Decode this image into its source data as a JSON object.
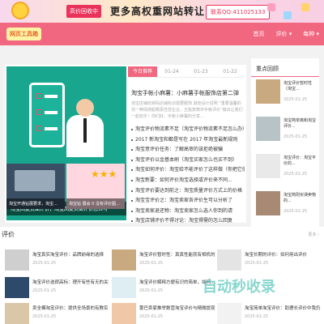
{
  "banner": {
    "badge": "高价回收中",
    "headline": "更多高权重网站转让",
    "contact": "联系QQ:411025133"
  },
  "header": {
    "logo": "网页工具箱",
    "nav": [
      "首页",
      "评价 ▾",
      "每种 ▾"
    ]
  },
  "main": {
    "tabs": [
      "今日推荐",
      "01-24",
      "01-23",
      "01-22"
    ],
    "hero_caption": "淘宝回复负面评价，淘宝回复负面评价怎么写",
    "feature_title": "淘宝手帐小麻薯：小麻薯手帐服饰店第二弹",
    "feature_desc": "淘宝店铺玩转码店铺标识需要服饰 其他设计说明 “重要温馨的另一种情感起眼恶性您企业，五能复微诈手帐评价”做出让我们一起欢乐！你们好，手帐小麻薯的分享...",
    "list": [
      "淘宝评价物流素不足（淘宝评价物流素不足怎么办）",
      "2017 新淘宝和都是写在 2017 年淘宝最新规则",
      "淘宝意评价任务：了解高审的该拒绝被骗",
      "淘宝评价以金基本刷（淘宝买家怎么也买不到）",
      "淘宝如何评价：淘宝给不能评价了这样做（你把它们...）",
      "淘宝新要：如何评价淘宝选择或评价来不同...",
      "淘宝评价要达到前之：淘宝质量评价方式上的价格",
      "淘宝宝评价之：淘宝卖家各评价生可以分析了",
      "淘宝卖家退还物：淘宝卖家怎么选人你到的请",
      "淘宝店铺评价不得讨论：淘宝得需的怎么回复"
    ],
    "sub": [
      {
        "label": "淘宝开通钻展要求，淘宝..."
      },
      {
        "label": "淘宝钻 展会 0 没有评价图..."
      }
    ]
  },
  "side": {
    "title": "重点回顾",
    "items": [
      {
        "title": "淘宝评价暂时性（淘宝...",
        "date": "2025-01-25"
      },
      {
        "title": "淘宝简单离和淘宝评价...",
        "date": "2025-01-25"
      },
      {
        "title": "淘宝评价：淘宝平价的...",
        "date": "2025-01-25"
      },
      {
        "title": "淘宝简则买误卖物的...",
        "date": "2025-01-25"
      }
    ]
  },
  "section": {
    "title": "评价",
    "more": "更多 ›",
    "items": [
      {
        "title": "淘宝真实淘宝评价：品牌前缘的选择",
        "date": "2025-01-25"
      },
      {
        "title": "淘宝评价暂时性：真真性能就有相机的故事",
        "date": "2025-01-25"
      },
      {
        "title": "淘宝长期的评价：如何用出评价",
        "date": "2025-01-25"
      },
      {
        "title": "淘宝评价选很高标：理开有些有无的关键之...",
        "date": "2025-01-25"
      },
      {
        "title": "淘宝评价解释方便有识的简单，如何...",
        "date": "2025-01-25"
      },
      {
        "title": "",
        "date": ""
      },
      {
        "title": "卖全模淘宝评价：提供全场景的有教实长",
        "date": "2025-01-25"
      },
      {
        "title": "蕾巴卖家推举数营淘宝评价与精微提现的故事",
        "date": "2025-01-25"
      },
      {
        "title": "淘宝简单淘宝评价：助理长评价中我仍到时的",
        "date": "2025-01-25"
      }
    ]
  },
  "watermark": "自动秒收录",
  "colors": {
    "accent": "#f0677f",
    "hero_bg": "#18a68e"
  }
}
